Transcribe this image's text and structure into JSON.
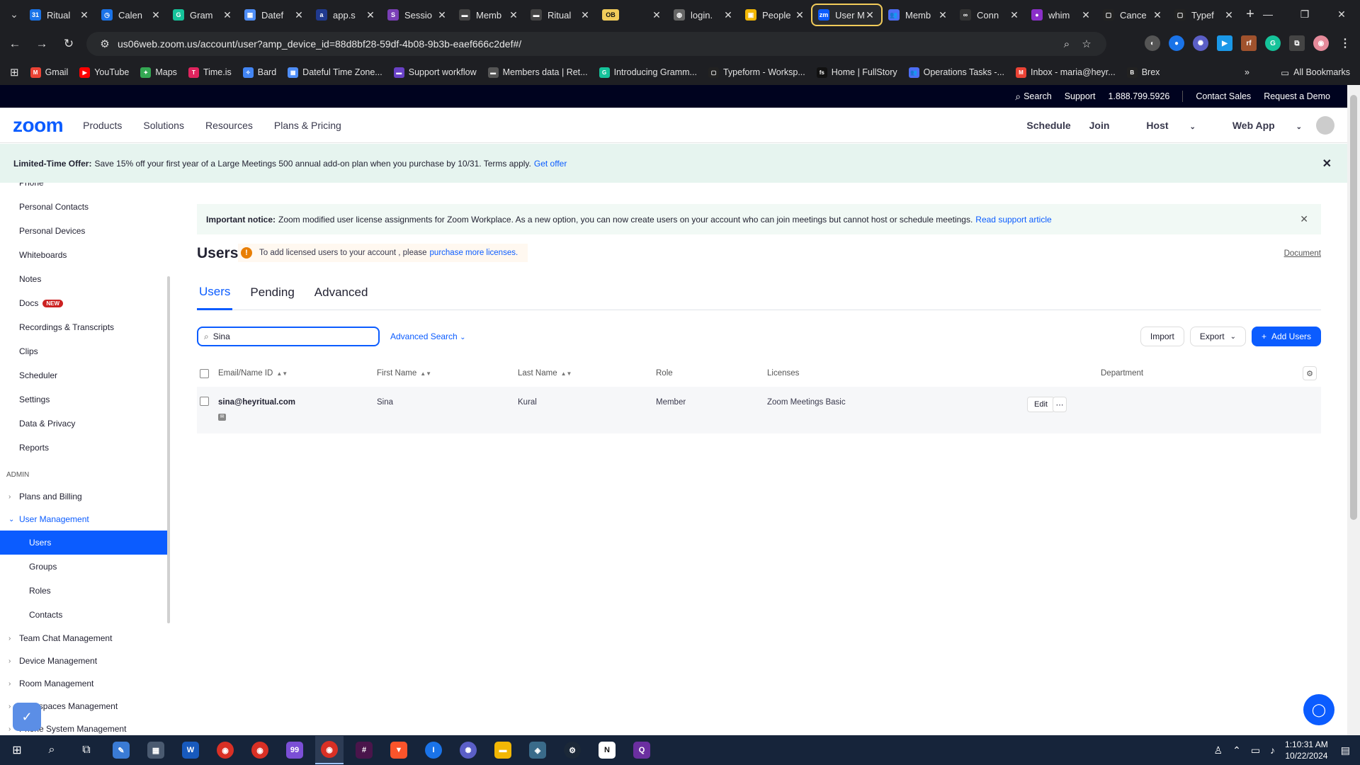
{
  "browser": {
    "tabs": [
      {
        "title": "Ritual",
        "color": "#1a73e8",
        "glyph": "31"
      },
      {
        "title": "Calen",
        "color": "#1a73e8",
        "glyph": "◷"
      },
      {
        "title": "Gram",
        "color": "#15c39a",
        "glyph": "G"
      },
      {
        "title": "Datef",
        "color": "#4f8ef7",
        "glyph": "▦"
      },
      {
        "title": "app.s",
        "color": "#203a8f",
        "glyph": "a"
      },
      {
        "title": "Sessio",
        "color": "#7a3fb6",
        "glyph": "S"
      },
      {
        "title": "Memb",
        "color": "#444",
        "glyph": "▬"
      },
      {
        "title": "Ritual",
        "color": "#444",
        "glyph": "▬"
      },
      {
        "title": "OB",
        "color": "#f2cc5a",
        "glyph": "OB"
      },
      {
        "title": "login.",
        "color": "#666",
        "glyph": "◍"
      },
      {
        "title": "People",
        "color": "#f2b705",
        "glyph": "▣"
      },
      {
        "title": "User M",
        "color": "#0b5cff",
        "glyph": "zm",
        "active": true
      },
      {
        "title": "Memb",
        "color": "#4c6ef5",
        "glyph": "👥"
      },
      {
        "title": "Conn",
        "color": "#333",
        "glyph": "∞"
      },
      {
        "title": "whim",
        "color": "#8b2fc9",
        "glyph": "●"
      },
      {
        "title": "Cance",
        "color": "#222",
        "glyph": "▢"
      },
      {
        "title": "Typef",
        "color": "#222",
        "glyph": "▢"
      }
    ],
    "url": "us06web.zoom.us/account/user?amp_device_id=88d8bf28-59df-4b08-9b3b-eaef666c2def#/",
    "bookmarks": [
      {
        "label": "Gmail",
        "color": "#ea4335",
        "glyph": "M"
      },
      {
        "label": "YouTube",
        "color": "#ff0000",
        "glyph": "▶"
      },
      {
        "label": "Maps",
        "color": "#34a853",
        "glyph": "✦"
      },
      {
        "label": "Time.is",
        "color": "#e0245e",
        "glyph": "T"
      },
      {
        "label": "Bard",
        "color": "#4285f4",
        "glyph": "✧"
      },
      {
        "label": "Dateful Time Zone...",
        "color": "#4f8ef7",
        "glyph": "▦"
      },
      {
        "label": "Support workflow",
        "color": "#6941c6",
        "glyph": "▬"
      },
      {
        "label": "Members data | Ret...",
        "color": "#555",
        "glyph": "▬"
      },
      {
        "label": "Introducing Gramm...",
        "color": "#15c39a",
        "glyph": "G"
      },
      {
        "label": "Typeform - Worksp...",
        "color": "#222",
        "glyph": "▢"
      },
      {
        "label": "Home | FullStory",
        "color": "#111",
        "glyph": "fs"
      },
      {
        "label": "Operations Tasks -...",
        "color": "#4c6ef5",
        "glyph": "👥"
      },
      {
        "label": "Inbox - maria@heyr...",
        "color": "#ea4335",
        "glyph": "M"
      },
      {
        "label": "Brex",
        "color": "#222",
        "glyph": "B"
      }
    ],
    "all_bookmarks": "All Bookmarks"
  },
  "zoom": {
    "topstrip": {
      "search": "Search",
      "support": "Support",
      "phone": "1.888.799.5926",
      "contact": "Contact Sales",
      "demo": "Request a Demo"
    },
    "logo": "zoom",
    "menu": [
      "Products",
      "Solutions",
      "Resources",
      "Plans & Pricing"
    ],
    "right": {
      "schedule": "Schedule",
      "join": "Join",
      "host": "Host",
      "webapp": "Web App"
    },
    "offer": {
      "bold": "Limited-Time Offer:",
      "text": "Save 15% off your first year of a Large Meetings 500 annual add-on plan when you purchase by 10/31. Terms apply.",
      "link": "Get offer"
    }
  },
  "sidebar": {
    "personal": [
      "Phone",
      "Personal Contacts",
      "Personal Devices",
      "Whiteboards",
      "Notes",
      "Docs",
      "Recordings & Transcripts",
      "Clips",
      "Scheduler",
      "Settings",
      "Data & Privacy",
      "Reports"
    ],
    "new_badge": "NEW",
    "admin_heading": "ADMIN",
    "plans": "Plans and Billing",
    "user_mgmt": "User Management",
    "user_mgmt_sub": [
      "Users",
      "Groups",
      "Roles",
      "Contacts"
    ],
    "more_groups": [
      "Team Chat Management",
      "Device Management",
      "Room Management",
      "Workspaces Management",
      "Phone System Management"
    ]
  },
  "main": {
    "notice": {
      "bold": "Important notice:",
      "text": "Zoom modified user license assignments for Zoom Workplace. As a new option, you can now create users on your account who can join meetings but cannot host or schedule meetings.",
      "link": "Read support article"
    },
    "title": "Users",
    "warning": {
      "text": "To add licensed users to your account , please",
      "link": "purchase more licenses."
    },
    "document": "Document",
    "tabs": [
      "Users",
      "Pending",
      "Advanced"
    ],
    "search_value": "Sina",
    "advanced_search": "Advanced Search",
    "buttons": {
      "import": "Import",
      "export": "Export",
      "add": "Add Users"
    },
    "columns": [
      "Email/Name ID",
      "First Name",
      "Last Name",
      "Role",
      "Licenses",
      "Department"
    ],
    "rows": [
      {
        "email": "sina@heyritual.com",
        "first": "Sina",
        "last": "Kural",
        "role": "Member",
        "license": "Zoom Meetings Basic"
      }
    ],
    "edit": "Edit"
  },
  "taskbar": {
    "time": "1:10:31 AM",
    "date": "10/22/2024"
  }
}
